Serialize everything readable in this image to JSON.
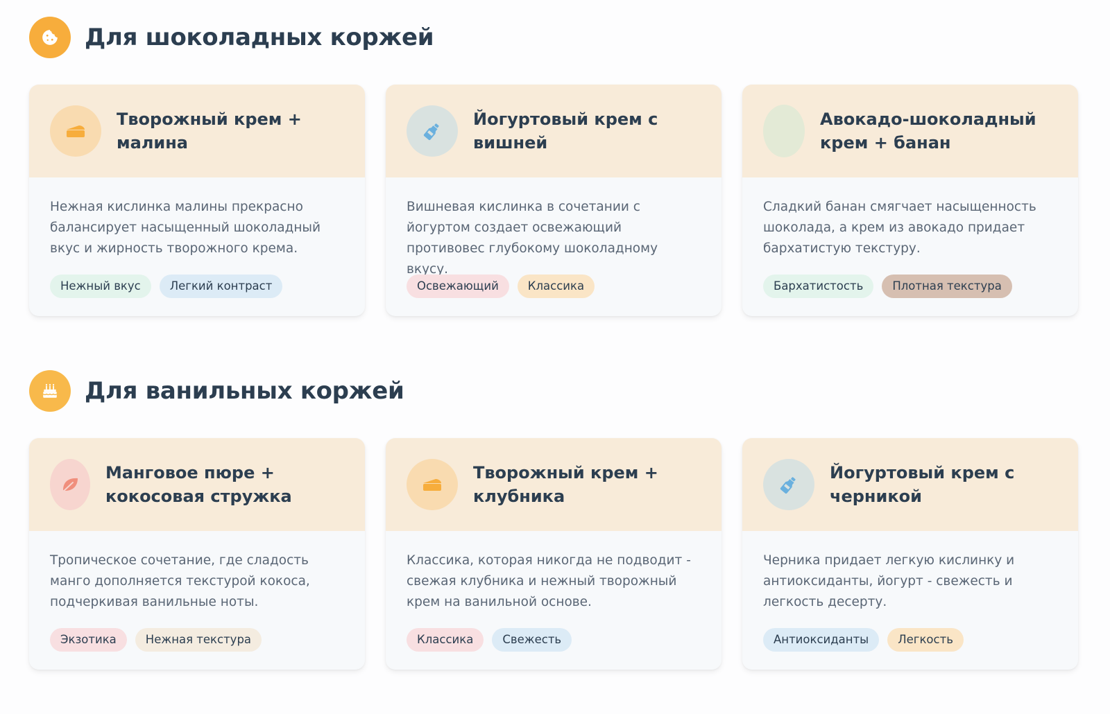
{
  "colors": {
    "accent": "#f7ad3c",
    "title": "#2c3e50",
    "text": "#5a6675",
    "card_head": "#f8ebd9",
    "card_body": "#f7f9fb"
  },
  "sections": [
    {
      "icon": "cookie-icon",
      "title": "Для шоколадных коржей",
      "cards": [
        {
          "icon": "cheese-icon",
          "icon_bg": "#f9dbb0",
          "title": "Творожный крем + малина",
          "description": "Нежная кислинка малины прекрасно балансирует насыщенный шоколадный вкус и жирность творожного крема.",
          "tags": [
            {
              "label": "Нежный вкус",
              "color": "green"
            },
            {
              "label": "Легкий контраст",
              "color": "blue"
            }
          ]
        },
        {
          "icon": "bottle-icon",
          "icon_bg": "#d9e2e0",
          "title": "Йогуртовый крем с вишней",
          "description": "Вишневая кислинка в сочетании с йогуртом создает освежающий противовес глубокому шоколадному вкусу.",
          "tags": [
            {
              "label": "Освежающий",
              "color": "red"
            },
            {
              "label": "Классика",
              "color": "orange"
            }
          ]
        },
        {
          "icon": "avocado-icon",
          "icon_bg": "#e3ead6",
          "title": "Авокадо-шоколадный крем + банан",
          "description": "Сладкий банан смягчает насыщенность шоколада, а крем из авокадо придает бархатистую текстуру.",
          "tags": [
            {
              "label": "Бархатистость",
              "color": "green"
            },
            {
              "label": "Плотная текстура",
              "color": "brown"
            }
          ]
        }
      ]
    },
    {
      "icon": "birthday-cake-icon",
      "title": "Для ванильных коржей",
      "cards": [
        {
          "icon": "leaf-icon",
          "icon_bg": "#f7d5cf",
          "title": "Манговое пюре + кокосовая стружка",
          "description": "Тропическое сочетание, где сладость манго дополняется текстурой кокоса, подчеркивая ванильные ноты.",
          "tags": [
            {
              "label": "Экзотика",
              "color": "red"
            },
            {
              "label": "Нежная текстура",
              "color": "beige"
            }
          ]
        },
        {
          "icon": "cheese-icon",
          "icon_bg": "#f9dbb0",
          "title": "Творожный крем + клубника",
          "description": "Классика, которая никогда не подводит - свежая клубника и нежный творожный крем на ванильной основе.",
          "tags": [
            {
              "label": "Классика",
              "color": "red"
            },
            {
              "label": "Свежесть",
              "color": "blue"
            }
          ]
        },
        {
          "icon": "bottle-icon",
          "icon_bg": "#d9e2e0",
          "title": "Йогуртовый крем с черникой",
          "description": "Черника придает легкую кислинку и антиоксиданты, йогурт - свежесть и легкость десерту.",
          "tags": [
            {
              "label": "Антиоксиданты",
              "color": "blue"
            },
            {
              "label": "Легкость",
              "color": "orange"
            }
          ]
        }
      ]
    }
  ]
}
